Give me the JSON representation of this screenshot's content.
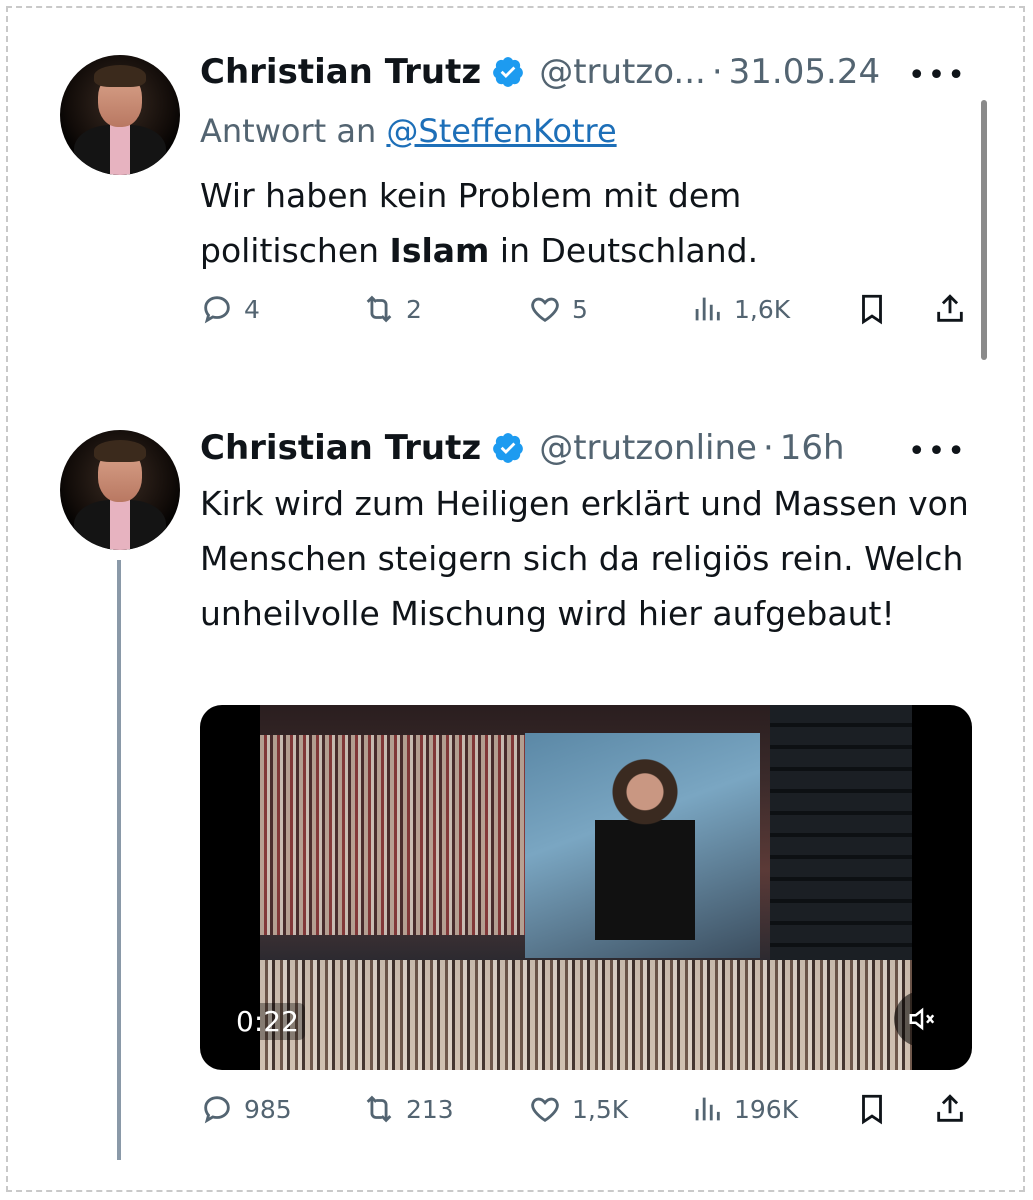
{
  "tweets": [
    {
      "author_name": "Christian Trutz",
      "handle": "@trutzo...",
      "separator": "·",
      "date": "31.05.24",
      "more": "•••",
      "reply_prefix": "Antwort an ",
      "reply_to": "@SteffenKotre",
      "text_before": "Wir haben kein Problem mit dem politischen ",
      "text_bold": "Islam",
      "text_after": " in Deutschland.",
      "replies": "4",
      "reposts": "2",
      "likes": "5",
      "views": "1,6K"
    },
    {
      "author_name": "Christian Trutz",
      "handle": "@trutzonline",
      "separator": "·",
      "date": "16h",
      "more": "•••",
      "text": "Kirk wird zum Heiligen erklärt und Massen von Menschen steigern sich da religiös rein. Welch unheilvolle Mischung wird hier aufgebaut!",
      "video_time": "0:22",
      "replies": "985",
      "reposts": "213",
      "likes": "1,5K",
      "views": "196K"
    }
  ],
  "icons": {
    "verified": "verified-badge-icon",
    "reply": "reply-icon",
    "repost": "repost-icon",
    "like": "like-icon",
    "views": "views-icon",
    "bookmark": "bookmark-icon",
    "share": "share-icon",
    "mute": "mute-icon"
  },
  "colors": {
    "verified_blue": "#1d9bf0",
    "link_blue": "#1d6fb8",
    "secondary_text": "#536471"
  }
}
